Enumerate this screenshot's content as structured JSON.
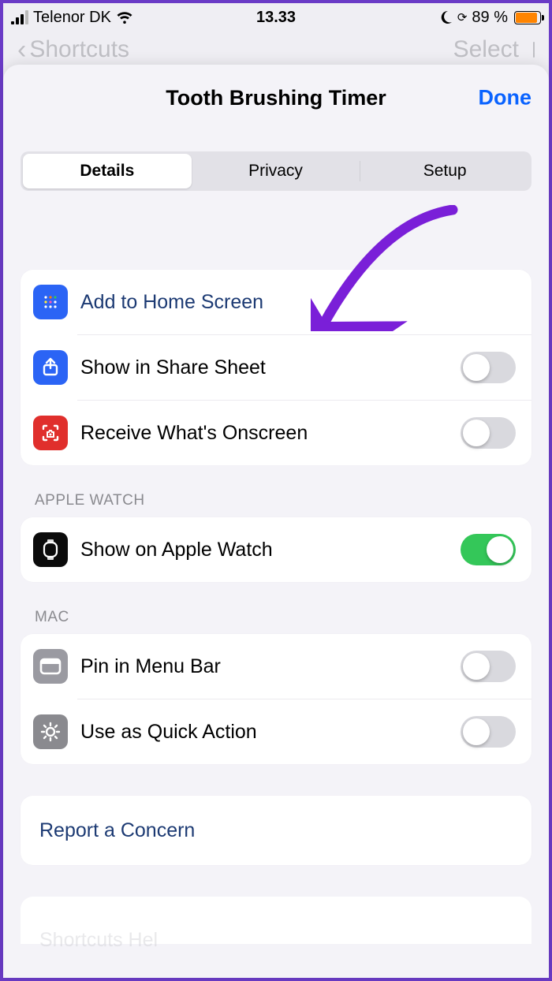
{
  "status": {
    "carrier": "Telenor DK",
    "time": "13.33",
    "battery_pct": "89 %"
  },
  "background": {
    "back_label": "Shortcuts",
    "select_label": "Select"
  },
  "sheet": {
    "title": "Tooth Brushing Timer",
    "done": "Done",
    "tabs": {
      "details": "Details",
      "privacy": "Privacy",
      "setup": "Setup"
    }
  },
  "group1": {
    "add_home": "Add to Home Screen",
    "share_sheet": "Show in Share Sheet",
    "onscreen": "Receive What's Onscreen"
  },
  "watch": {
    "header": "Apple Watch",
    "show": "Show on Apple Watch"
  },
  "mac": {
    "header": "Mac",
    "pin": "Pin in Menu Bar",
    "quick": "Use as Quick Action"
  },
  "report": "Report a Concern",
  "peek_bottom": "Shortcuts Hel…"
}
